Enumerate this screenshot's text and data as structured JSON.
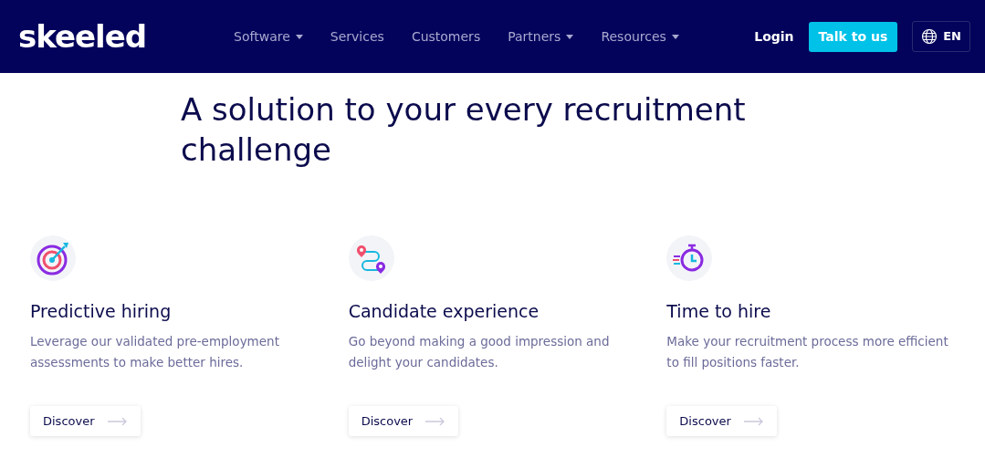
{
  "logo": "skeeled",
  "nav": [
    {
      "label": "Software",
      "dropdown": true
    },
    {
      "label": "Services",
      "dropdown": false
    },
    {
      "label": "Customers",
      "dropdown": false
    },
    {
      "label": "Partners",
      "dropdown": true
    },
    {
      "label": "Resources",
      "dropdown": true
    }
  ],
  "login": "Login",
  "cta": "Talk to us",
  "language": "EN",
  "heading": "A solution to your every recruitment challenge",
  "features": [
    {
      "kind": "target",
      "title": "Predictive hiring",
      "text": "Leverage our validated pre-employment assessments to make better hires.",
      "button": "Discover"
    },
    {
      "kind": "route",
      "title": "Candidate experience",
      "text": "Go beyond making a good impression and delight your candidates.",
      "button": "Discover"
    },
    {
      "kind": "stopwatch",
      "title": "Time to hire",
      "text": "Make your recruitment process more efficient to fill positions faster.",
      "button": "Discover"
    }
  ]
}
